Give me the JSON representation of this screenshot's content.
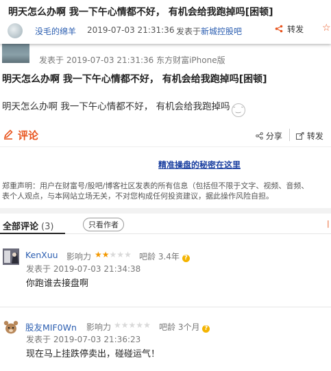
{
  "header": {
    "title": "明天怎么办啊 我一下午心情都不好， 有机会给我跑掉吗[困顿]",
    "username": "没毛的绵羊",
    "time": "2019-07-03 21:31:36",
    "from_prefix": "发表于",
    "from_link": "新城控股吧",
    "share_label": "转发",
    "share_icon": "share-icon",
    "fav_icon": "star-icon"
  },
  "post": {
    "meta": "发表于 2019-07-03 21:31:36 东方财富iPhone版",
    "title": "明天怎么办啊 我一下午心情都不好， 有机会给我跑掉吗[困顿]",
    "body": "明天怎么办啊 我一下午心情都不好， 有机会给我跑掉吗"
  },
  "actions": {
    "comment_label": "评论",
    "share_label": "分享",
    "repost_label": "转发"
  },
  "ad_link": "精准操盘的秘密在这里",
  "disclaimer": [
    "郑重声明：用户在财富号/股吧/博客社区发表的所有信息（包括但不限于文字、视频、音频、",
    "表个人观点，与本网站立场无关，不对您构成任何投资建议，据此操作风险自担。"
  ],
  "comments_header": {
    "all_label": "全部评论",
    "count": "(3)",
    "only_author": "只看作者"
  },
  "comments": [
    {
      "username": "KenXuu",
      "influence_label": "影响力",
      "rating": 2,
      "max_rating": 5,
      "age_label": "吧龄 3.4年",
      "time": "发表于  2019-07-03 21:34:38",
      "text": "你跑谁去接盘啊"
    },
    {
      "username": "股友MIF0Wn",
      "influence_label": "影响力",
      "rating": 0,
      "max_rating": 5,
      "age_label": "吧龄 3个月",
      "time": "发表于  2019-07-03 21:36:23",
      "text": "现在马上挂跌停卖出，碰碰运气！"
    }
  ]
}
